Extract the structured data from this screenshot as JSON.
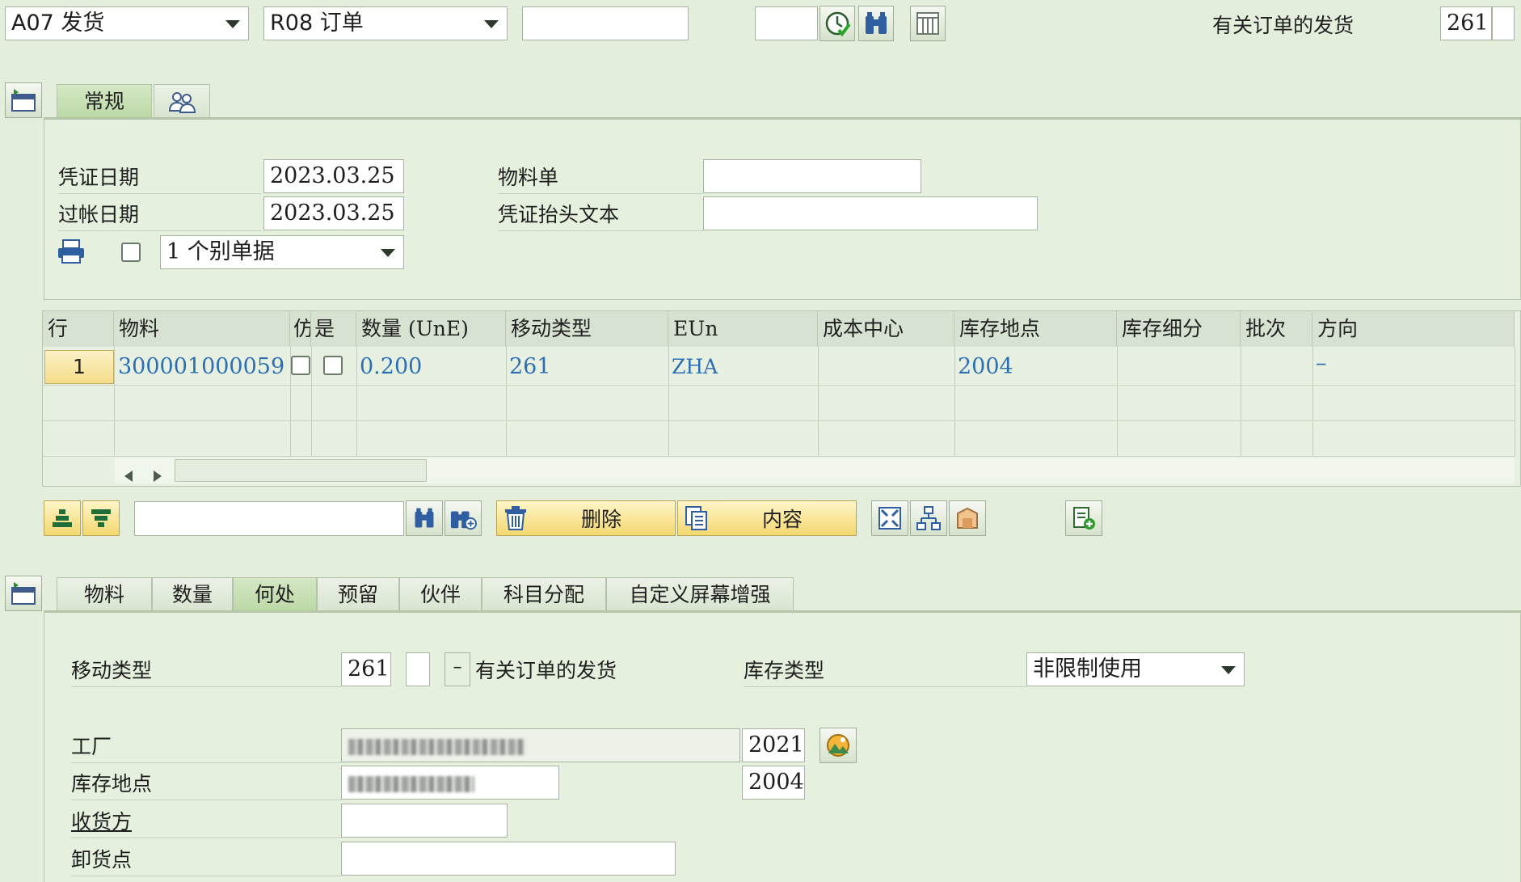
{
  "toolbar": {
    "action_select": "A07 发货",
    "reference_select": "R08 订单",
    "reference_input": "",
    "small_input": "",
    "movement_desc": "有关订单的发货",
    "movement_code": "261"
  },
  "header_tabs": [
    {
      "label": "常规",
      "active": true
    },
    {
      "label": "",
      "icon": "partner-icon"
    }
  ],
  "header": {
    "doc_date_label": "凭证日期",
    "doc_date_value": "2023.03.25",
    "post_date_label": "过帐日期",
    "post_date_value": "2023.03.25",
    "material_slip_label": "物料单",
    "material_slip_value": "",
    "header_text_label": "凭证抬头文本",
    "header_text_value": "",
    "print_option": "1 个别单据"
  },
  "table": {
    "columns": [
      "行",
      "物料",
      "仿",
      "是",
      "数量 (UnE)",
      "移动类型",
      "EUn",
      "成本中心",
      "库存地点",
      "库存细分",
      "批次",
      "方向"
    ],
    "rows": [
      {
        "line": "1",
        "material": "300001000059",
        "qty": "0.200",
        "mvt": "261",
        "unit": "ZHA",
        "cost_center": "",
        "storage": "2004",
        "stock_seg": "",
        "batch": "",
        "direction": "–"
      }
    ]
  },
  "item_toolbar": {
    "search_input": "",
    "delete_label": "删除",
    "content_label": "内容"
  },
  "detail_tabs": [
    {
      "label": "物料"
    },
    {
      "label": "数量"
    },
    {
      "label": "何处",
      "active": true
    },
    {
      "label": "预留"
    },
    {
      "label": "伙伴"
    },
    {
      "label": "科目分配"
    },
    {
      "label": "自定义屏幕增强"
    }
  ],
  "detail": {
    "mvt_type_label": "移动类型",
    "mvt_type_value": "261",
    "mvt_type_sign": "–",
    "mvt_type_text": "有关订单的发货",
    "stock_type_label": "库存类型",
    "stock_type_value": "非限制使用",
    "plant_label": "工厂",
    "plant_code": "2021",
    "storage_label": "库存地点",
    "storage_code": "2004",
    "recipient_label": "收货方",
    "recipient_value": "",
    "unload_label": "卸货点",
    "unload_value": ""
  },
  "colors": {
    "background": "#e4eedc",
    "link_blue": "#2c6fb5",
    "active_tab": "#bcd8a6",
    "yellow_button": "#f3d770"
  }
}
